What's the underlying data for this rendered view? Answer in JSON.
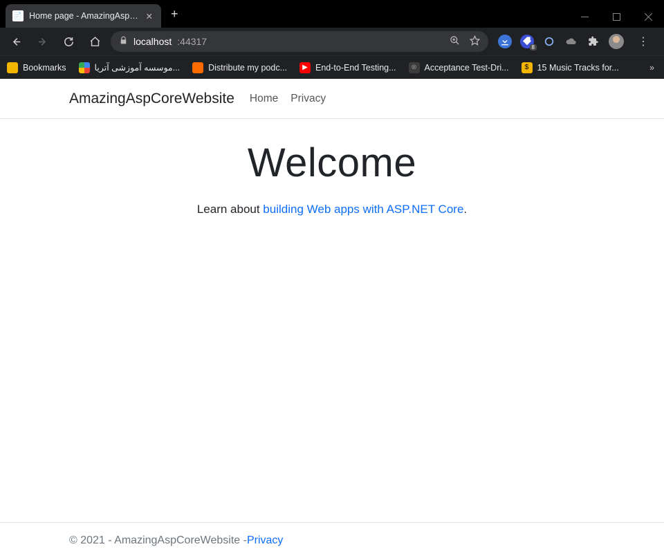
{
  "browser": {
    "tab_title": "Home page - AmazingAspCoreW",
    "url_host": "localhost",
    "url_port": ":44317",
    "bookmarks": [
      {
        "label": "Bookmarks",
        "style": "bm-folder"
      },
      {
        "label": "موسسه آموزشی آتریا...",
        "style": "bm-google"
      },
      {
        "label": "Distribute my podc...",
        "style": "bm-orange"
      },
      {
        "label": "End-to-End Testing...",
        "style": "bm-yt"
      },
      {
        "label": "Acceptance Test-Dri...",
        "style": "bm-dark"
      },
      {
        "label": "15 Music Tracks for...",
        "style": "bm-yellow"
      }
    ],
    "ext_badge": "8"
  },
  "site": {
    "brand": "AmazingAspCoreWebsite",
    "nav": {
      "home": "Home",
      "privacy": "Privacy"
    },
    "hero_heading": "Welcome",
    "hero_lead": "Learn about ",
    "hero_link": "building Web apps with ASP.NET Core",
    "hero_trail": ".",
    "footer_text": "© 2021 - AmazingAspCoreWebsite - ",
    "footer_link": "Privacy"
  }
}
